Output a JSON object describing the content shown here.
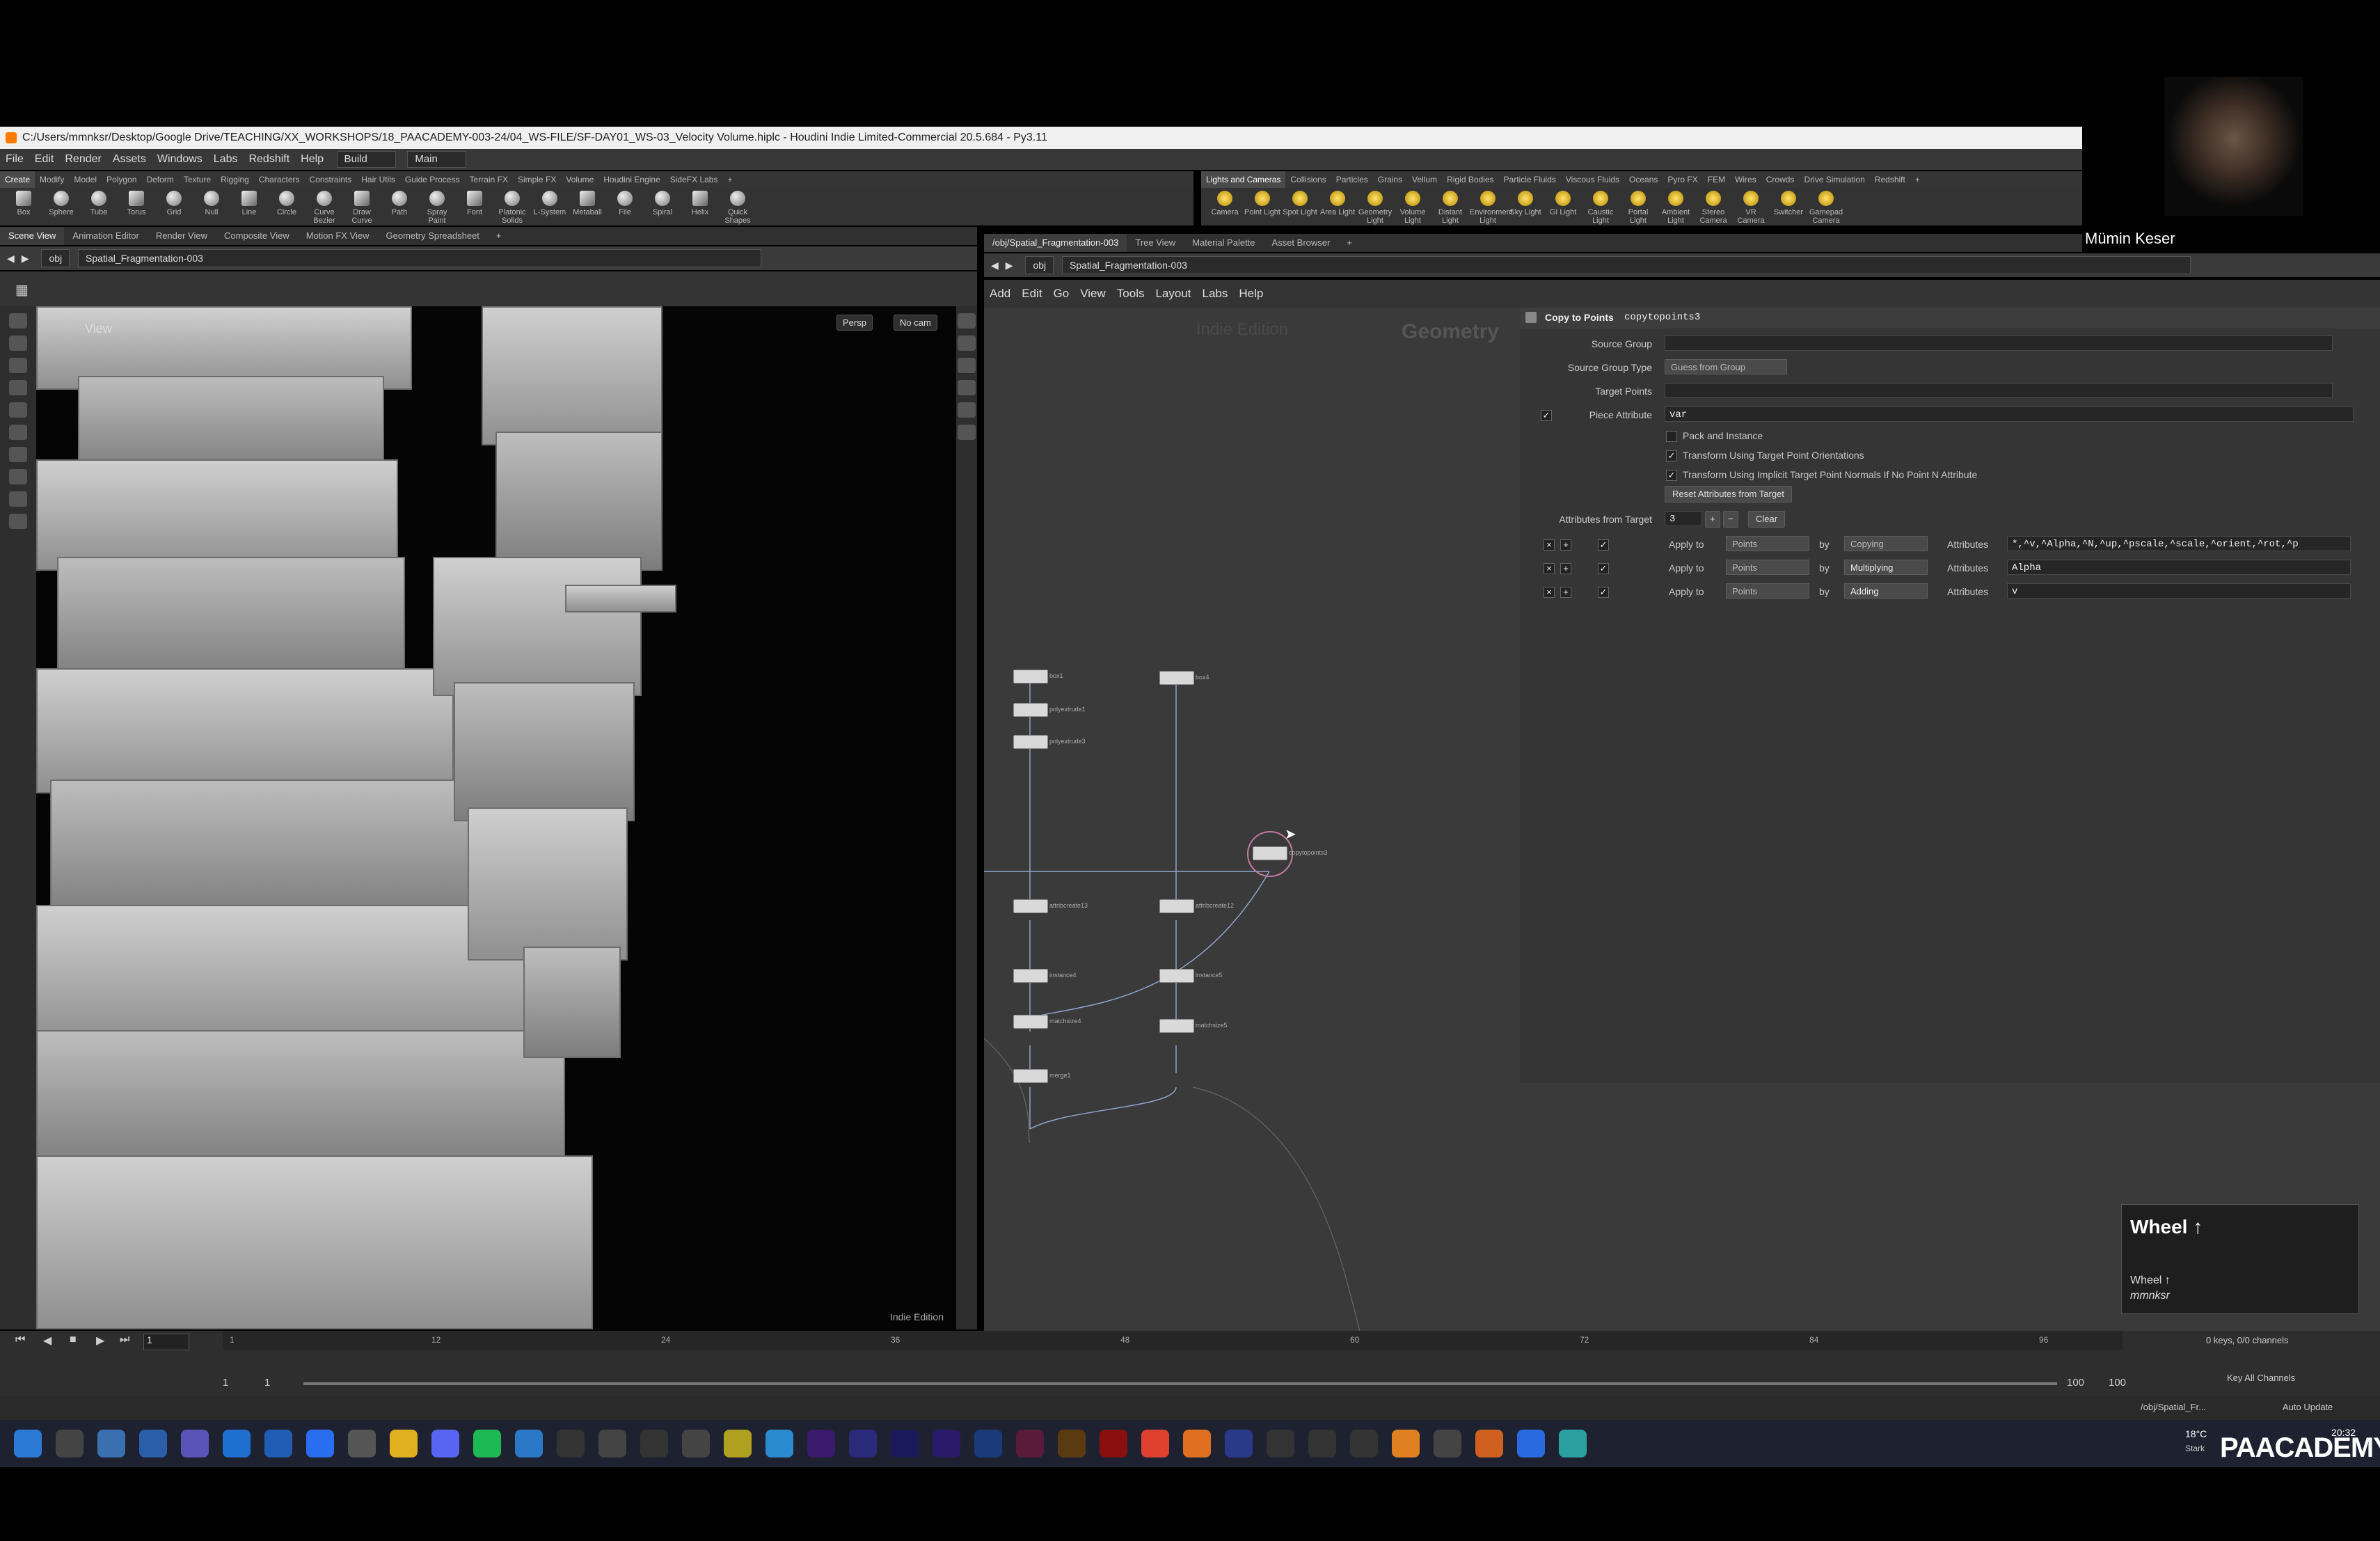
{
  "window": {
    "title": "C:/Users/mmnksr/Desktop/Google Drive/TEACHING/XX_WORKSHOPS/18_PAACADEMY-003-24/04_WS-FILE/SF-DAY01_WS-03_Velocity Volume.hiplc - Houdini Indie Limited-Commercial 20.5.684 - Py3.11"
  },
  "menubar": {
    "items": [
      "File",
      "Edit",
      "Render",
      "Assets",
      "Windows",
      "Labs",
      "Redshift",
      "Help"
    ],
    "desktop": "Build",
    "workspace": "Main"
  },
  "shelf_left": {
    "tabs": [
      "Create",
      "Modify",
      "Model",
      "Polygon",
      "Deform",
      "Texture",
      "Rigging",
      "Characters",
      "Constraints",
      "Hair Utils",
      "Guide Process",
      "Terrain FX",
      "Simple FX",
      "Volume",
      "Houdini Engine",
      "SideFX Labs"
    ],
    "tools": [
      "Box",
      "Sphere",
      "Tube",
      "Torus",
      "Grid",
      "Null",
      "Line",
      "Circle",
      "Curve Bezier",
      "Draw Curve",
      "Path",
      "Spray Paint",
      "Font",
      "Platonic Solids",
      "L-System",
      "Metaball",
      "File",
      "Spiral",
      "Helix",
      "Quick Shapes"
    ]
  },
  "shelf_right": {
    "tabs": [
      "Lights and Cameras",
      "Collisions",
      "Particles",
      "Grains",
      "Vellum",
      "Rigid Bodies",
      "Particle Fluids",
      "Viscous Fluids",
      "Oceans",
      "Pyro FX",
      "FEM",
      "Wires",
      "Crowds",
      "Drive Simulation",
      "Redshift"
    ],
    "tools": [
      "Camera",
      "Point Light",
      "Spot Light",
      "Area Light",
      "Geometry Light",
      "Volume Light",
      "Distant Light",
      "Environment Light",
      "Sky Light",
      "GI Light",
      "Caustic Light",
      "Portal Light",
      "Ambient Light",
      "Stereo Camera",
      "VR Camera",
      "Switcher",
      "Gamepad Camera"
    ]
  },
  "left_pane": {
    "tabs": [
      "Scene View",
      "Animation Editor",
      "Render View",
      "Composite View",
      "Motion FX View",
      "Geometry Spreadsheet"
    ],
    "path_root": "obj",
    "path_node": "Spatial_Fragmentation-003",
    "view_label": "View",
    "persp": "Persp",
    "cam": "No cam",
    "edition": "Indie Edition"
  },
  "right_pane": {
    "tabs": [
      "/obj/Spatial_Fragmentation-003",
      "Tree View",
      "Material Palette",
      "Asset Browser"
    ],
    "path_root": "obj",
    "path_node": "Spatial_Fragmentation-003",
    "menu": [
      "Add",
      "Edit",
      "Go",
      "View",
      "Tools",
      "Layout",
      "Labs",
      "Help"
    ],
    "watermark_edition": "Indie Edition",
    "watermark_context": "Geometry"
  },
  "network_nodes": [
    {
      "label": "box1"
    },
    {
      "label": "polyextrude1"
    },
    {
      "label": "polyextrude3"
    },
    {
      "label": "box4"
    },
    {
      "label": "attribcreate13"
    },
    {
      "label": "attribcreate12"
    },
    {
      "label": "instance4"
    },
    {
      "label": "instance5"
    },
    {
      "label": "matchsize4"
    },
    {
      "label": "matchsize5"
    },
    {
      "label": "merge1"
    },
    {
      "label": "copytopoints3"
    }
  ],
  "params": {
    "node_type": "Copy to Points",
    "node_name": "copytopoints3",
    "source_group_label": "Source Group",
    "source_group_value": "",
    "source_group_type_label": "Source Group Type",
    "source_group_type_value": "Guess from Group",
    "target_points_label": "Target Points",
    "target_points_value": "",
    "piece_attribute_label": "Piece Attribute",
    "piece_attribute_value": "var",
    "pack_instance": "Pack and Instance",
    "transform_orient": "Transform Using Target Point Orientations",
    "transform_normals": "Transform Using Implicit Target Point Normals If No Point N Attribute",
    "reset_button": "Reset Attributes from Target",
    "attrs_from_target_label": "Attributes from Target",
    "attrs_from_target_value": "3",
    "clear_button": "Clear",
    "rows": [
      {
        "apply_label": "Apply to",
        "apply_value": "Points",
        "by_label": "by",
        "by_value": "Copying",
        "attr_label": "Attributes",
        "attr_value": "*,^v,^Alpha,^N,^up,^pscale,^scale,^orient,^rot,^p"
      },
      {
        "apply_label": "Apply to",
        "apply_value": "Points",
        "by_label": "by",
        "by_value": "Multiplying",
        "attr_label": "Attributes",
        "attr_value": "Alpha"
      },
      {
        "apply_label": "Apply to",
        "apply_value": "Points",
        "by_label": "by",
        "by_value": "Adding",
        "attr_label": "Attributes",
        "attr_value": "v"
      }
    ]
  },
  "tooltip": {
    "title": "Wheel ↑",
    "line1": "Wheel ↑",
    "line2": "mmnksr"
  },
  "timeline": {
    "current_frame": "1",
    "start": "1",
    "start2": "1",
    "end": "100",
    "end2": "100",
    "keys": "0 keys, 0/0 channels",
    "key_all": "Key All Channels",
    "status_path": "/obj/Spatial_Fr...",
    "auto_update": "Auto Update",
    "ticks": [
      "1",
      "12",
      "24",
      "36",
      "48",
      "60",
      "72",
      "84",
      "96"
    ]
  },
  "webcam": {
    "name": "Mümin Keser"
  },
  "taskbar": {
    "weather": "18°C",
    "weather_sub": "Stark",
    "clock": "20:32",
    "brand": "PAACADEMY"
  }
}
